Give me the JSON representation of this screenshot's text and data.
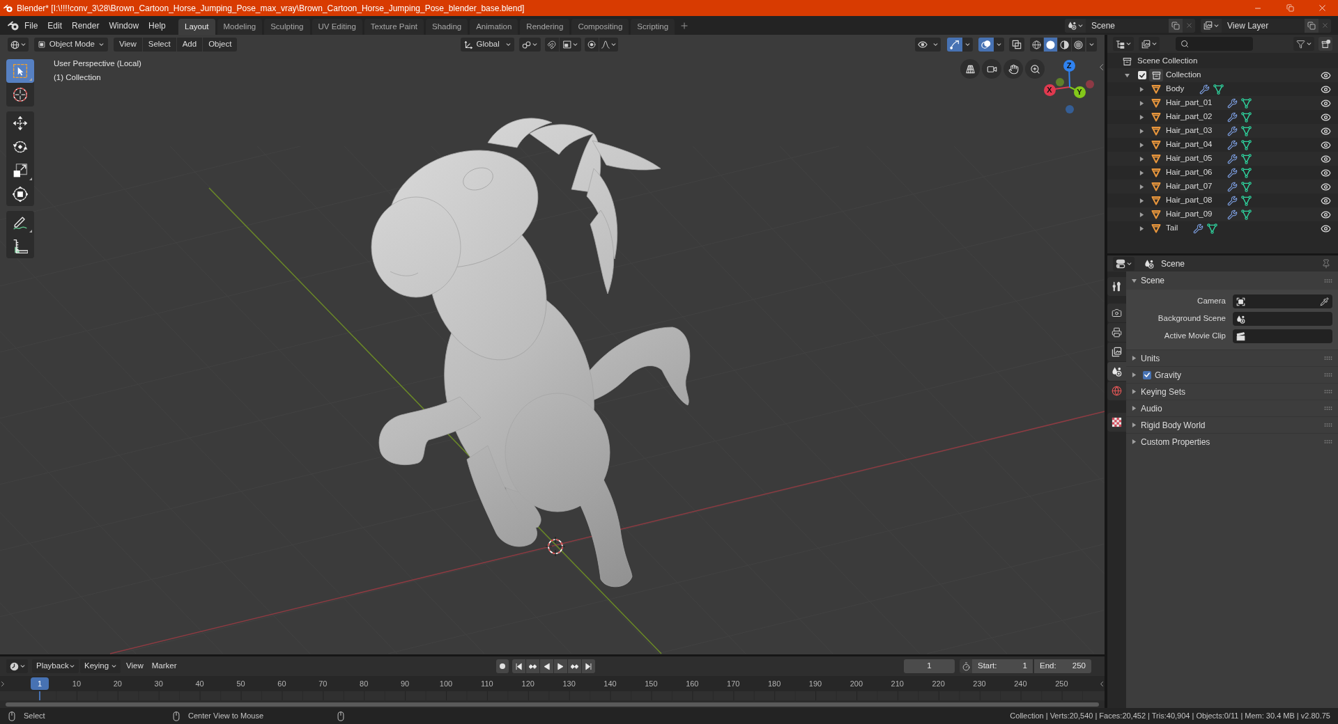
{
  "window": {
    "title": "Blender* [I:\\!!!!conv_3\\28\\Brown_Cartoon_Horse_Jumping_Pose_max_vray\\Brown_Cartoon_Horse_Jumping_Pose_blender_base.blend]"
  },
  "menu_bar": {
    "items": [
      "File",
      "Edit",
      "Render",
      "Window",
      "Help"
    ]
  },
  "workspace_tabs": [
    {
      "label": "Layout",
      "selected": true
    },
    {
      "label": "Modeling",
      "selected": false
    },
    {
      "label": "Sculpting",
      "selected": false
    },
    {
      "label": "UV Editing",
      "selected": false
    },
    {
      "label": "Texture Paint",
      "selected": false
    },
    {
      "label": "Shading",
      "selected": false
    },
    {
      "label": "Animation",
      "selected": false
    },
    {
      "label": "Rendering",
      "selected": false
    },
    {
      "label": "Compositing",
      "selected": false
    },
    {
      "label": "Scripting",
      "selected": false
    }
  ],
  "scene": {
    "value": "Scene"
  },
  "view_layer": {
    "value": "View Layer"
  },
  "viewport_header": {
    "mode": "Object Mode",
    "menus": [
      "View",
      "Select",
      "Add",
      "Object"
    ],
    "orientation": "Global",
    "toggles": [
      {
        "kind": "visibility",
        "on": false
      },
      {
        "kind": "gizmo",
        "on": true
      },
      {
        "kind": "overlay",
        "on": true
      },
      {
        "kind": "xray",
        "on": false
      }
    ],
    "shading": [
      {
        "kind": "wireframe",
        "selected": false
      },
      {
        "kind": "solid",
        "selected": true
      },
      {
        "kind": "material",
        "selected": false
      },
      {
        "kind": "rendered",
        "selected": false
      }
    ]
  },
  "toolbar": [
    {
      "kind": "select_box",
      "selected": true
    },
    {
      "kind": "cursor",
      "selected": false
    },
    {
      "kind": "move",
      "selected": false
    },
    {
      "kind": "rotate",
      "selected": false
    },
    {
      "kind": "scale",
      "selected": false
    },
    {
      "kind": "transform",
      "selected": false
    },
    {
      "kind": "annotate",
      "selected": false
    },
    {
      "kind": "measure",
      "selected": false
    }
  ],
  "viewport": {
    "view_name": "User Perspective (Local)",
    "collection": "(1) Collection",
    "gizmo_axes": [
      {
        "label": "X",
        "color": "#e0394f"
      },
      {
        "label": "Y",
        "color": "#84c81a"
      },
      {
        "label": "Z",
        "color": "#2f82f0"
      }
    ]
  },
  "outliner": {
    "root": "Scene Collection",
    "collection": {
      "label": "Collection",
      "checked": true,
      "expanded": true,
      "visible": true,
      "children": [
        {
          "label": "Body",
          "expanded": false,
          "visible": true
        },
        {
          "label": "Hair_part_01",
          "expanded": false,
          "visible": true
        },
        {
          "label": "Hair_part_02",
          "expanded": false,
          "visible": true
        },
        {
          "label": "Hair_part_03",
          "expanded": false,
          "visible": true
        },
        {
          "label": "Hair_part_04",
          "expanded": false,
          "visible": true
        },
        {
          "label": "Hair_part_05",
          "expanded": false,
          "visible": true
        },
        {
          "label": "Hair_part_06",
          "expanded": false,
          "visible": true
        },
        {
          "label": "Hair_part_07",
          "expanded": false,
          "visible": true
        },
        {
          "label": "Hair_part_08",
          "expanded": false,
          "visible": true
        },
        {
          "label": "Hair_part_09",
          "expanded": false,
          "visible": true
        },
        {
          "label": "Tail",
          "expanded": false,
          "visible": true
        }
      ]
    }
  },
  "properties": {
    "context": "Scene",
    "tabs": [
      {
        "kind": "tool",
        "selected": false
      },
      {
        "kind": "render",
        "selected": false
      },
      {
        "kind": "output",
        "selected": false
      },
      {
        "kind": "view_layer",
        "selected": false
      },
      {
        "kind": "scene",
        "selected": true
      },
      {
        "kind": "world",
        "selected": false
      },
      {
        "kind": "texture",
        "selected": false
      }
    ],
    "panels": [
      {
        "label": "Scene",
        "expanded": true,
        "fields": [
          {
            "label": "Camera",
            "kind": "camera"
          },
          {
            "label": "Background Scene",
            "kind": "scene"
          },
          {
            "label": "Active Movie Clip",
            "kind": "clip"
          }
        ]
      },
      {
        "label": "Units",
        "expanded": false
      },
      {
        "label": "Gravity",
        "expanded": false,
        "checked": true
      },
      {
        "label": "Keying Sets",
        "expanded": false
      },
      {
        "label": "Audio",
        "expanded": false
      },
      {
        "label": "Rigid Body World",
        "expanded": false
      },
      {
        "label": "Custom Properties",
        "expanded": false
      }
    ]
  },
  "timeline": {
    "dropdowns": [
      "Playback",
      "Keying"
    ],
    "menus": [
      "View",
      "Marker"
    ],
    "current_frame": "1",
    "start_label": "Start:",
    "start": "1",
    "end_label": "End:",
    "end": "250",
    "playhead": "1",
    "ruler": [
      "10",
      "20",
      "30",
      "40",
      "50",
      "60",
      "70",
      "80",
      "90",
      "100",
      "110",
      "120",
      "130",
      "140",
      "150",
      "160",
      "170",
      "180",
      "190",
      "200",
      "210",
      "220",
      "230",
      "240",
      "250"
    ]
  },
  "status_bar": {
    "hints": [
      "Select",
      "Center View to Mouse"
    ],
    "stats": "Collection | Verts:20,540 | Faces:20,452 | Tris:40,904 | Objects:0/11 | Mem: 30.4 MB | v2.80.75"
  }
}
